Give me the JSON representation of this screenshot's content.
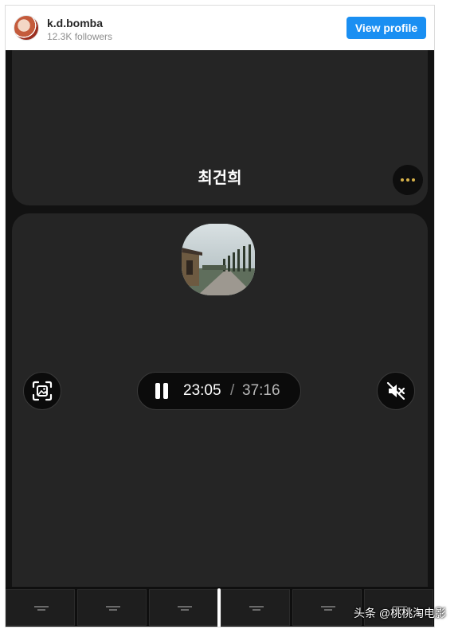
{
  "embed": {
    "user_name": "k.d.bomba",
    "followers": "12.3K followers",
    "view_profile_label": "View profile"
  },
  "video": {
    "card_title": "최건희",
    "time_current": "23:05",
    "time_separator": "/",
    "time_total": "37:16",
    "muted": true,
    "icons": [
      "more-icon",
      "photo-capture-icon",
      "pause-icon",
      "muted-speaker-icon"
    ]
  },
  "watermark": "头条 @桃桃淘电影",
  "colors": {
    "accent": "#1a8ff2",
    "video_background": "#121212",
    "card_background": "#252525",
    "more_dots": "#d7b24a"
  }
}
